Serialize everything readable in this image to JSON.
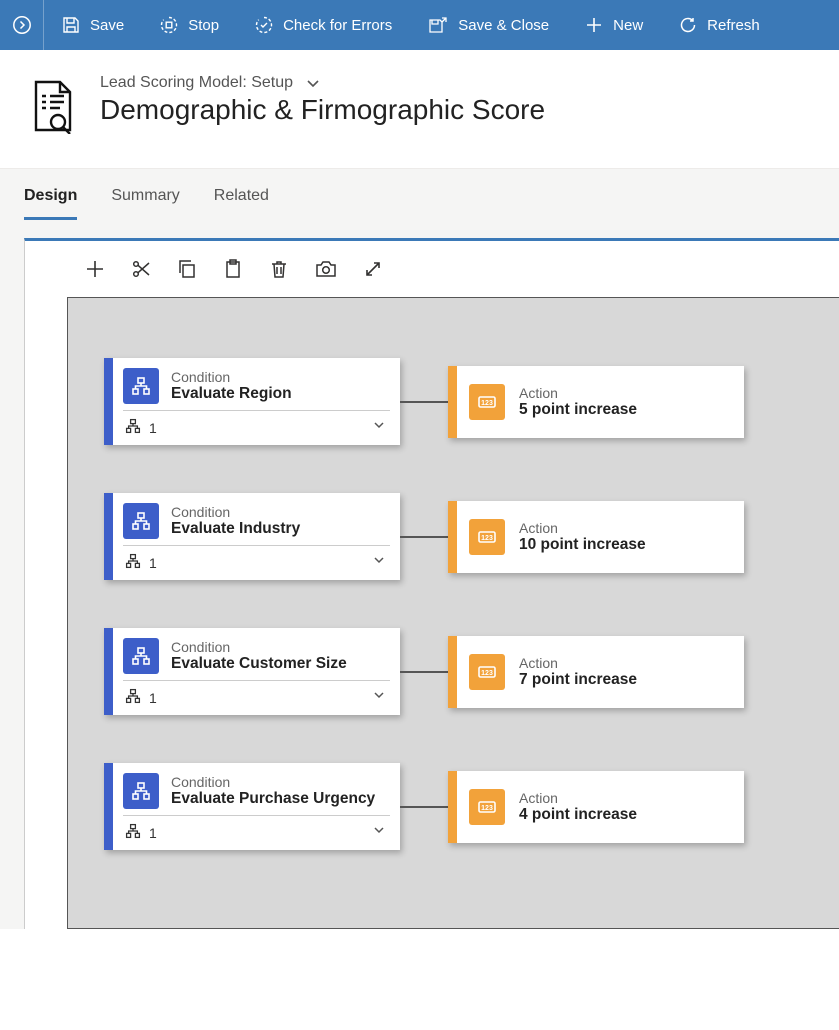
{
  "commandbar": {
    "save": "Save",
    "stop": "Stop",
    "check": "Check for Errors",
    "saveclose": "Save & Close",
    "new": "New",
    "refresh": "Refresh"
  },
  "header": {
    "breadcrumb": "Lead Scoring Model: Setup",
    "title": "Demographic & Firmographic Score"
  },
  "tabs": {
    "design": "Design",
    "summary": "Summary",
    "related": "Related"
  },
  "rows": [
    {
      "kind": "Condition",
      "title": "Evaluate Region",
      "count": "1",
      "actionKind": "Action",
      "actionTitle": "5 point increase"
    },
    {
      "kind": "Condition",
      "title": "Evaluate Industry",
      "count": "1",
      "actionKind": "Action",
      "actionTitle": "10 point increase"
    },
    {
      "kind": "Condition",
      "title": "Evaluate Customer Size",
      "count": "1",
      "actionKind": "Action",
      "actionTitle": "7 point increase"
    },
    {
      "kind": "Condition",
      "title": "Evaluate Purchase Urgency",
      "count": "1",
      "actionKind": "Action",
      "actionTitle": "4 point increase"
    }
  ]
}
